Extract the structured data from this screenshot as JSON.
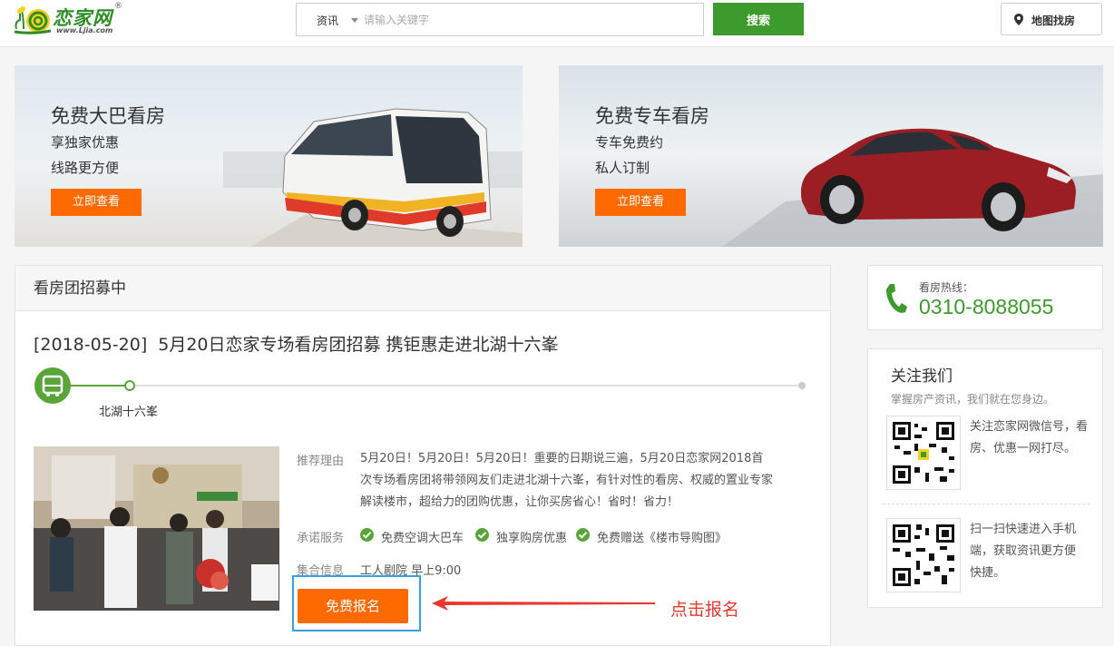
{
  "header": {
    "logo_text": "恋家网",
    "logo_reg": "®",
    "logo_url": "www.Ljia.com",
    "search_type": "资讯",
    "search_placeholder": "请输入关键字",
    "search_button": "搜索",
    "map_button": "地图找房"
  },
  "banners": [
    {
      "title": "免费大巴看房",
      "line1": "享独家优惠",
      "line2": "线路更方便",
      "button": "立即查看"
    },
    {
      "title": "免费专车看房",
      "line1": "专车免费约",
      "line2": "私人订制",
      "button": "立即查看"
    }
  ],
  "panel": {
    "heading": "看房团招募中",
    "article": {
      "date": "[2018-05-20]",
      "title": "5月20日恋家专场看房团招募 携钜惠走进北湖十六峯",
      "route_stop": "北湖十六峯",
      "reason_label": "推荐理由",
      "reason": "5月20日！5月20日！5月20日！重要的日期说三遍，5月20日恋家网2018首次专场看房团将带领网友们走进北湖十六峯，有针对性的看房、权威的置业专家解读楼市，超给力的团购优惠，让你买房省心！省时！省力！",
      "service_label": "承诺服务",
      "services": [
        "免费空调大巴车",
        "独享购房优惠",
        "免费赠送《楼市导购图》"
      ],
      "meet_label": "集合信息",
      "meet": "工人剧院 早上9:00",
      "signup_button": "免费报名",
      "annotation": "点击报名"
    }
  },
  "sidebar": {
    "hotline_label": "看房热线：",
    "hotline_number": "0310-8088055",
    "follow_title": "关注我们",
    "follow_sub": "掌握房产资讯，我们就在您身边。",
    "qr1_text": "关注恋家网微信号，看房、优惠一网打尽。",
    "qr2_text": "扫一扫快速进入手机端，获取资讯更方便 快捷。"
  },
  "colors": {
    "brand_green": "#3d9a2c",
    "accent_orange": "#ff6a00",
    "annotation_red": "#e8382f",
    "highlight_blue": "#3a9fe0"
  }
}
